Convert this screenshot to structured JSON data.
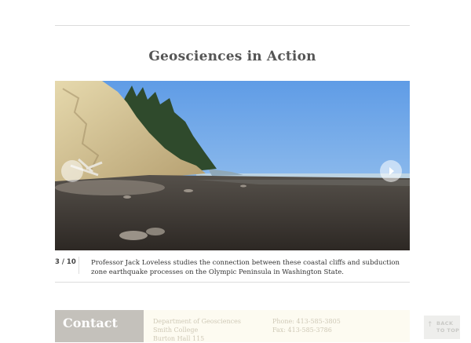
{
  "section": {
    "title": "Geosciences in Action"
  },
  "slideshow": {
    "counter": "3 / 10",
    "caption": "Professor Jack Loveless studies the connection between these coastal cliffs and subduction zone earthquake processes on the Olympic Peninsula in Washington State.",
    "prev_icon": "chevron-left-icon",
    "next_icon": "play-right-icon"
  },
  "footer": {
    "contact_title": "Contact",
    "address_lines": [
      "Department of Geosciences",
      "Smith College",
      "Burton Hall 115"
    ],
    "phone": "Phone: 413-585-3805",
    "fax": "Fax: 413-585-3786"
  },
  "back_to_top": {
    "line1": "BACK",
    "line2": "TO TOP",
    "icon": "arrow-up-icon"
  },
  "colors": {
    "sky": "#6aa6e8",
    "sand": "#3a3430",
    "cliff": "#d8c89a",
    "contact_tab": "#c4c1bb",
    "footer_bg": "#fdfbf1"
  }
}
